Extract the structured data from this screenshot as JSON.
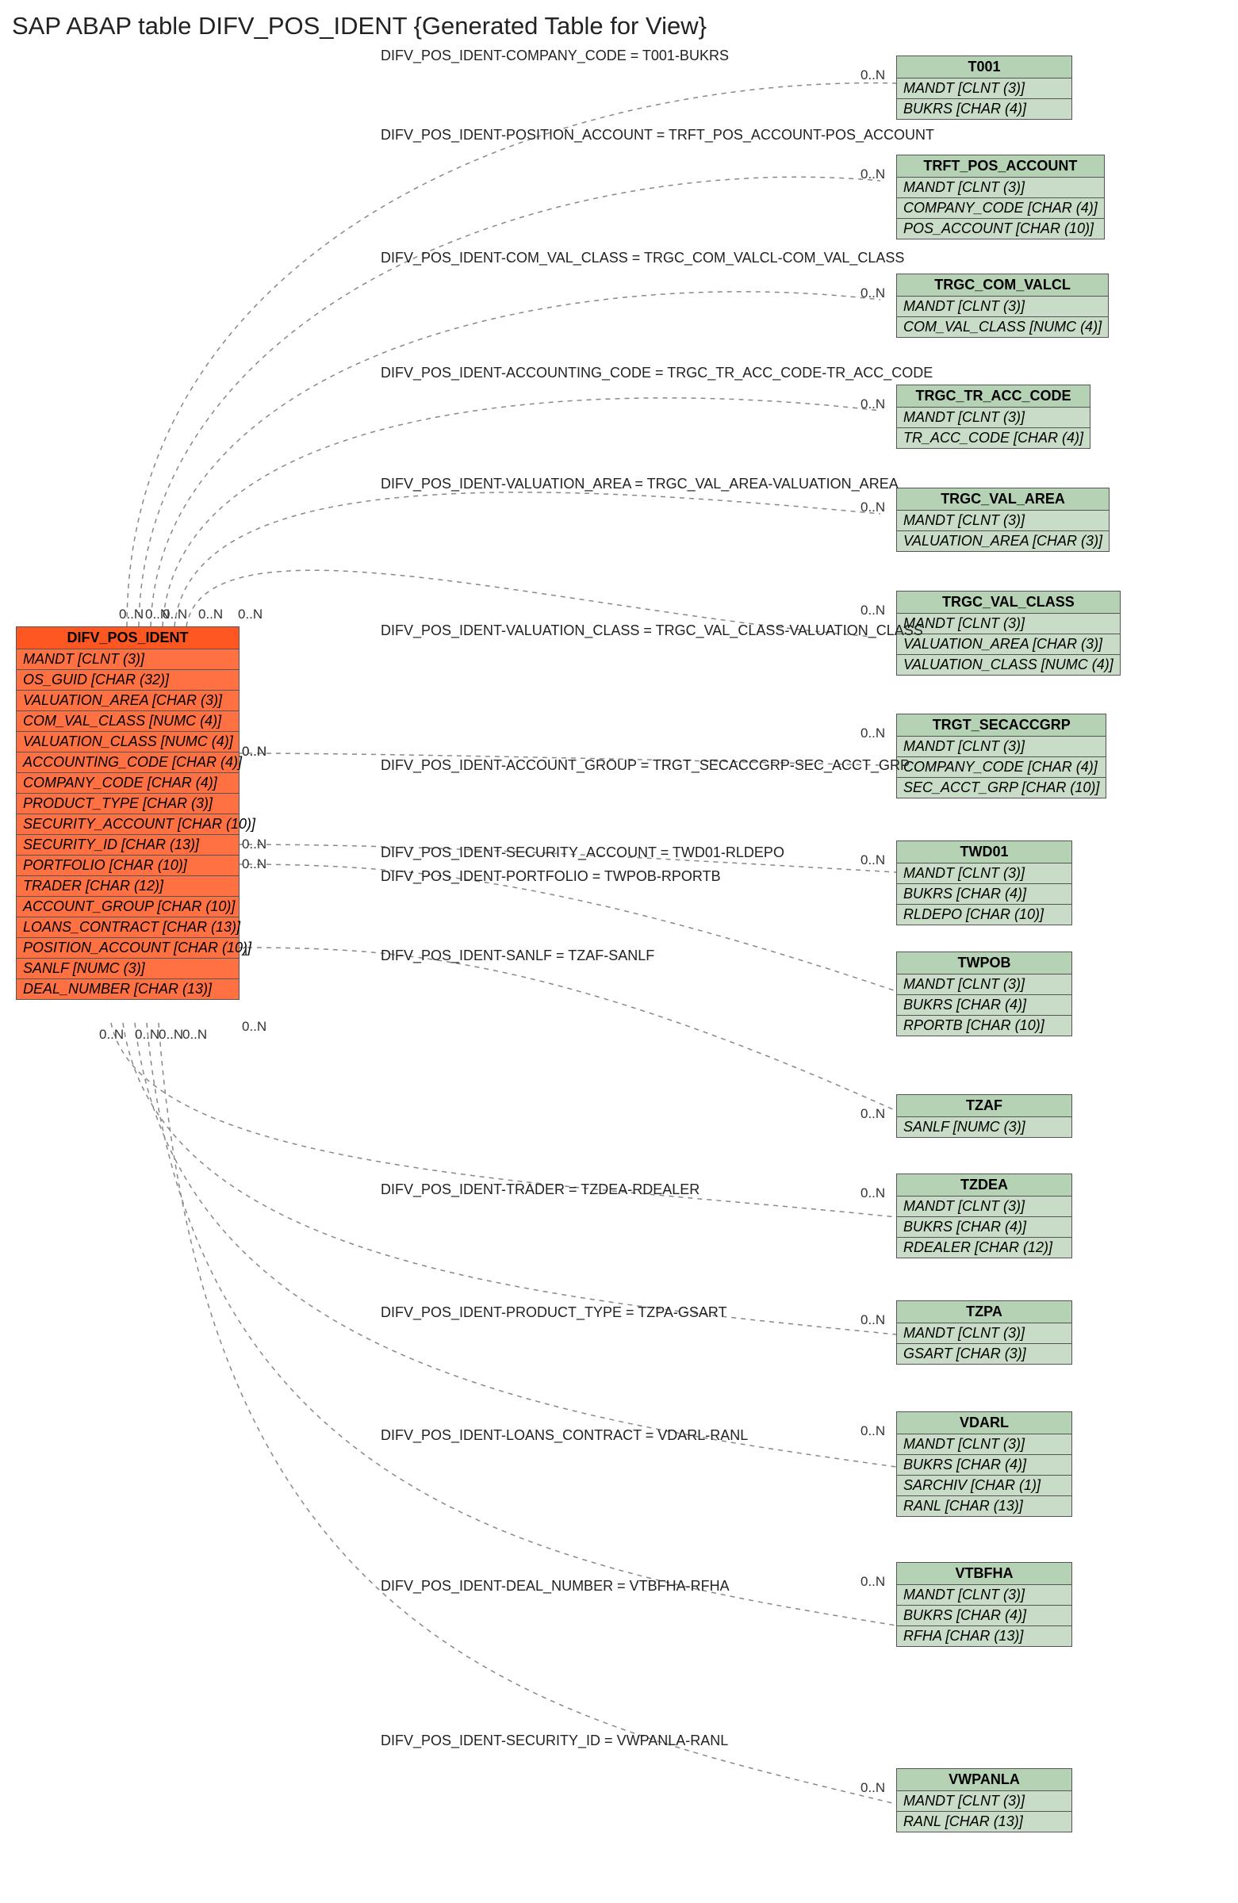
{
  "title": "SAP ABAP table DIFV_POS_IDENT {Generated Table for View}",
  "main_entity": {
    "name": "DIFV_POS_IDENT",
    "fields": [
      "MANDT [CLNT (3)]",
      "OS_GUID [CHAR (32)]",
      "VALUATION_AREA [CHAR (3)]",
      "COM_VAL_CLASS [NUMC (4)]",
      "VALUATION_CLASS [NUMC (4)]",
      "ACCOUNTING_CODE [CHAR (4)]",
      "COMPANY_CODE [CHAR (4)]",
      "PRODUCT_TYPE [CHAR (3)]",
      "SECURITY_ACCOUNT [CHAR (10)]",
      "SECURITY_ID [CHAR (13)]",
      "PORTFOLIO [CHAR (10)]",
      "TRADER [CHAR (12)]",
      "ACCOUNT_GROUP [CHAR (10)]",
      "LOANS_CONTRACT [CHAR (13)]",
      "POSITION_ACCOUNT [CHAR (10)]",
      "SANLF [NUMC (3)]",
      "DEAL_NUMBER [CHAR (13)]"
    ]
  },
  "relations": [
    {
      "label": "DIFV_POS_IDENT-COMPANY_CODE = T001-BUKRS",
      "target": {
        "name": "T001",
        "fields": [
          "MANDT [CLNT (3)]",
          "BUKRS [CHAR (4)]"
        ]
      }
    },
    {
      "label": "DIFV_POS_IDENT-POSITION_ACCOUNT = TRFT_POS_ACCOUNT-POS_ACCOUNT",
      "target": {
        "name": "TRFT_POS_ACCOUNT",
        "fields": [
          "MANDT [CLNT (3)]",
          "COMPANY_CODE [CHAR (4)]",
          "POS_ACCOUNT [CHAR (10)]"
        ]
      }
    },
    {
      "label": "DIFV_POS_IDENT-COM_VAL_CLASS = TRGC_COM_VALCL-COM_VAL_CLASS",
      "target": {
        "name": "TRGC_COM_VALCL",
        "fields": [
          "MANDT [CLNT (3)]",
          "COM_VAL_CLASS [NUMC (4)]"
        ]
      }
    },
    {
      "label": "DIFV_POS_IDENT-ACCOUNTING_CODE = TRGC_TR_ACC_CODE-TR_ACC_CODE",
      "target": {
        "name": "TRGC_TR_ACC_CODE",
        "fields": [
          "MANDT [CLNT (3)]",
          "TR_ACC_CODE [CHAR (4)]"
        ]
      }
    },
    {
      "label": "DIFV_POS_IDENT-VALUATION_AREA = TRGC_VAL_AREA-VALUATION_AREA",
      "target": {
        "name": "TRGC_VAL_AREA",
        "fields": [
          "MANDT [CLNT (3)]",
          "VALUATION_AREA [CHAR (3)]"
        ]
      }
    },
    {
      "label": "DIFV_POS_IDENT-VALUATION_CLASS = TRGC_VAL_CLASS-VALUATION_CLASS",
      "target": {
        "name": "TRGC_VAL_CLASS",
        "fields": [
          "MANDT [CLNT (3)]",
          "VALUATION_AREA [CHAR (3)]",
          "VALUATION_CLASS [NUMC (4)]"
        ]
      }
    },
    {
      "label": "DIFV_POS_IDENT-ACCOUNT_GROUP = TRGT_SECACCGRP-SEC_ACCT_GRP",
      "target": {
        "name": "TRGT_SECACCGRP",
        "fields": [
          "MANDT [CLNT (3)]",
          "COMPANY_CODE [CHAR (4)]",
          "SEC_ACCT_GRP [CHAR (10)]"
        ]
      }
    },
    {
      "label": "DIFV_POS_IDENT-SECURITY_ACCOUNT = TWD01-RLDEPO",
      "target": {
        "name": "TWD01",
        "fields": [
          "MANDT [CLNT (3)]",
          "BUKRS [CHAR (4)]",
          "RLDEPO [CHAR (10)]"
        ]
      }
    },
    {
      "label": "DIFV_POS_IDENT-PORTFOLIO = TWPOB-RPORTB",
      "target": {
        "name": "TWPOB",
        "fields": [
          "MANDT [CLNT (3)]",
          "BUKRS [CHAR (4)]",
          "RPORTB [CHAR (10)]"
        ]
      }
    },
    {
      "label": "DIFV_POS_IDENT-SANLF = TZAF-SANLF",
      "target": {
        "name": "TZAF",
        "fields": [
          "SANLF [NUMC (3)]"
        ]
      }
    },
    {
      "label": "DIFV_POS_IDENT-TRADER = TZDEA-RDEALER",
      "target": {
        "name": "TZDEA",
        "fields": [
          "MANDT [CLNT (3)]",
          "BUKRS [CHAR (4)]",
          "RDEALER [CHAR (12)]"
        ]
      }
    },
    {
      "label": "DIFV_POS_IDENT-PRODUCT_TYPE = TZPA-GSART",
      "target": {
        "name": "TZPA",
        "fields": [
          "MANDT [CLNT (3)]",
          "GSART [CHAR (3)]"
        ]
      }
    },
    {
      "label": "DIFV_POS_IDENT-LOANS_CONTRACT = VDARL-RANL",
      "target": {
        "name": "VDARL",
        "fields": [
          "MANDT [CLNT (3)]",
          "BUKRS [CHAR (4)]",
          "SARCHIV [CHAR (1)]",
          "RANL [CHAR (13)]"
        ]
      }
    },
    {
      "label": "DIFV_POS_IDENT-DEAL_NUMBER = VTBFHA-RFHA",
      "target": {
        "name": "VTBFHA",
        "fields": [
          "MANDT [CLNT (3)]",
          "BUKRS [CHAR (4)]",
          "RFHA [CHAR (13)]"
        ]
      }
    },
    {
      "label": "DIFV_POS_IDENT-SECURITY_ID = VWPANLA-RANL",
      "target": {
        "name": "VWPANLA",
        "fields": [
          "MANDT [CLNT (3)]",
          "RANL [CHAR (13)]"
        ]
      }
    }
  ],
  "card_left": [
    "0..N",
    "0..N",
    "0..N",
    "0..N",
    "0..N",
    "0..N",
    "0..N",
    "0..N",
    "0..N",
    "1",
    "0..N",
    "0..N",
    "0..N",
    "0..N",
    "0..N"
  ],
  "card_right": [
    "0..N",
    "0..N",
    "0..N",
    "0..N",
    "0..N",
    "0..N",
    "0..N",
    "0..N",
    "",
    "0..N",
    "0..N",
    "0..N",
    "0..N",
    "0..N",
    "0..N"
  ],
  "chart_data": {
    "type": "er-diagram",
    "main": "DIFV_POS_IDENT",
    "joins": [
      {
        "from": "DIFV_POS_IDENT.COMPANY_CODE",
        "to": "T001.BUKRS",
        "card": "0..N:0..N"
      },
      {
        "from": "DIFV_POS_IDENT.POSITION_ACCOUNT",
        "to": "TRFT_POS_ACCOUNT.POS_ACCOUNT",
        "card": "0..N:0..N"
      },
      {
        "from": "DIFV_POS_IDENT.COM_VAL_CLASS",
        "to": "TRGC_COM_VALCL.COM_VAL_CLASS",
        "card": "0..N:0..N"
      },
      {
        "from": "DIFV_POS_IDENT.ACCOUNTING_CODE",
        "to": "TRGC_TR_ACC_CODE.TR_ACC_CODE",
        "card": "0..N:0..N"
      },
      {
        "from": "DIFV_POS_IDENT.VALUATION_AREA",
        "to": "TRGC_VAL_AREA.VALUATION_AREA",
        "card": "0..N:0..N"
      },
      {
        "from": "DIFV_POS_IDENT.VALUATION_CLASS",
        "to": "TRGC_VAL_CLASS.VALUATION_CLASS",
        "card": "0..N:0..N"
      },
      {
        "from": "DIFV_POS_IDENT.ACCOUNT_GROUP",
        "to": "TRGT_SECACCGRP.SEC_ACCT_GRP",
        "card": "0..N:0..N"
      },
      {
        "from": "DIFV_POS_IDENT.SECURITY_ACCOUNT",
        "to": "TWD01.RLDEPO",
        "card": "0..N:0..N"
      },
      {
        "from": "DIFV_POS_IDENT.PORTFOLIO",
        "to": "TWPOB.RPORTB",
        "card": "0..N:"
      },
      {
        "from": "DIFV_POS_IDENT.SANLF",
        "to": "TZAF.SANLF",
        "card": "1:0..N"
      },
      {
        "from": "DIFV_POS_IDENT.TRADER",
        "to": "TZDEA.RDEALER",
        "card": "0..N:0..N"
      },
      {
        "from": "DIFV_POS_IDENT.PRODUCT_TYPE",
        "to": "TZPA.GSART",
        "card": "0..N:0..N"
      },
      {
        "from": "DIFV_POS_IDENT.LOANS_CONTRACT",
        "to": "VDARL.RANL",
        "card": "0..N:0..N"
      },
      {
        "from": "DIFV_POS_IDENT.DEAL_NUMBER",
        "to": "VTBFHA.RFHA",
        "card": "0..N:0..N"
      },
      {
        "from": "DIFV_POS_IDENT.SECURITY_ID",
        "to": "VWPANLA.RANL",
        "card": "0..N:0..N"
      }
    ]
  }
}
